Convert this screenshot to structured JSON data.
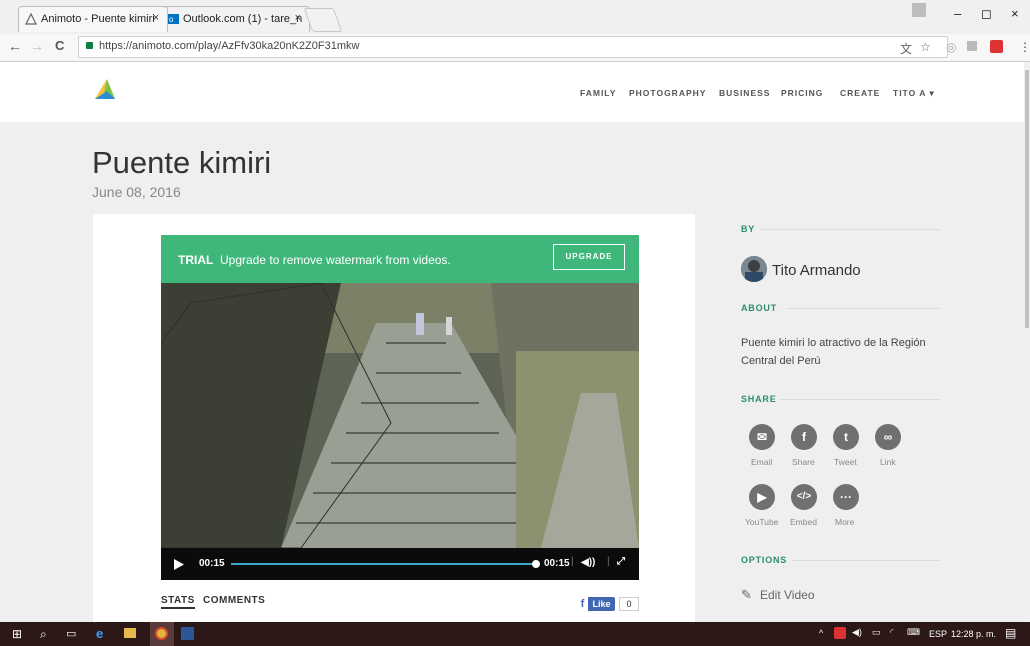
{
  "browser": {
    "tabs": [
      {
        "title": "Animoto - Puente kimiri",
        "close": "×"
      },
      {
        "title": "Outlook.com (1) - tare_n",
        "close": "×"
      }
    ],
    "url": "https://animoto.com/play/AzFfv30ka20nK2Z0F31mkw",
    "window_controls": {
      "minimize": "–",
      "restore": "◻",
      "close": "×"
    },
    "nav": {
      "back": "←",
      "forward": "→",
      "reload": "C"
    }
  },
  "site": {
    "nav": [
      "FAMILY",
      "PHOTOGRAPHY",
      "BUSINESS",
      "PRICING",
      "CREATE",
      "TITO A"
    ],
    "nav_caret": "▾",
    "brand_colors": {
      "green": "#40b77a",
      "accent": "#2c8f69"
    }
  },
  "video": {
    "title": "Puente kimiri",
    "date": "June 08, 2016",
    "trial_label": "TRIAL",
    "trial_text": "Upgrade to remove watermark from videos.",
    "upgrade_label": "UPGRADE",
    "time_current": "00:15",
    "time_total": "00:15",
    "progress_fraction": 1.0
  },
  "tabs": {
    "stats": "STATS",
    "comments": "COMMENTS"
  },
  "facebook": {
    "like": "Like",
    "count": "0"
  },
  "sidebar": {
    "by_heading": "BY",
    "author": "Tito Armando",
    "about_heading": "ABOUT",
    "about_text": "Puente kimiri lo atractivo de la Región Central del Perú",
    "share_heading": "SHARE",
    "share_items": [
      {
        "label": "Email",
        "icon": "email-icon"
      },
      {
        "label": "Share",
        "icon": "facebook-icon"
      },
      {
        "label": "Tweet",
        "icon": "twitter-icon"
      },
      {
        "label": "Link",
        "icon": "link-icon"
      },
      {
        "label": "YouTube",
        "icon": "youtube-icon"
      },
      {
        "label": "Embed",
        "icon": "embed-icon"
      },
      {
        "label": "More",
        "icon": "more-icon"
      }
    ],
    "options_heading": "OPTIONS",
    "edit_video": "Edit Video"
  },
  "taskbar": {
    "language": "ESP",
    "clock": "12:28 p. m."
  }
}
